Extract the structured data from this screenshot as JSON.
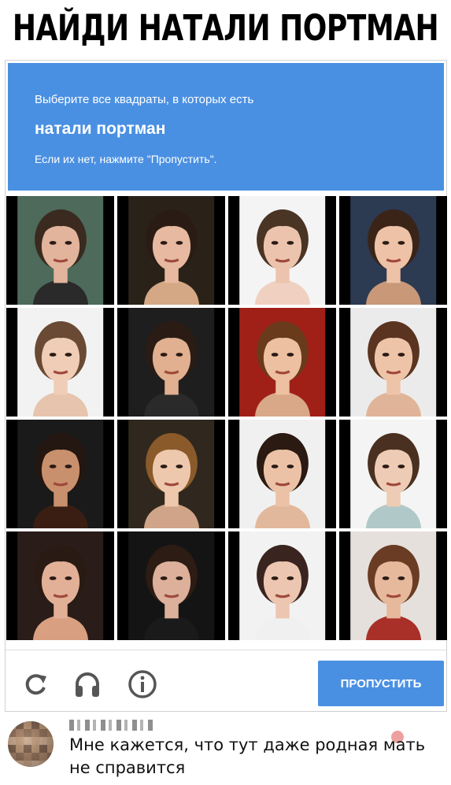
{
  "meme_title": "НАЙДИ НАТАЛИ ПОРТМАН",
  "captcha": {
    "instruction": "Выберите все квадраты, в которых есть",
    "target": "натали портман",
    "hint": "Если их нет, нажмите \"Пропустить\".",
    "skip_label": "ПРОПУСТИТЬ",
    "header_color": "#4a90e2",
    "tiles": [
      {
        "bg": "#4d6a5a",
        "hair": "#3a2a20",
        "skin": "#e2b49c",
        "clothes": "#2a2a2a"
      },
      {
        "bg": "#2a2218",
        "hair": "#2a1c14",
        "skin": "#e6b9a0",
        "clothes": "#d4a884"
      },
      {
        "bg": "#f4f4f4",
        "hair": "#4a3424",
        "skin": "#ecc4ae",
        "clothes": "#f0d0c0"
      },
      {
        "bg": "#2c3a52",
        "hair": "#3a2418",
        "skin": "#eec2a6",
        "clothes": "#c89878"
      },
      {
        "bg": "#f2f2f2",
        "hair": "#6a4a34",
        "skin": "#f0cdb6",
        "clothes": "#e6c4ae"
      },
      {
        "bg": "#1e1e1e",
        "hair": "#2a1c14",
        "skin": "#e0b090",
        "clothes": "#2a2a2a"
      },
      {
        "bg": "#a02018",
        "hair": "#6a3a1c",
        "skin": "#ecc0a0",
        "clothes": "#d8a888"
      },
      {
        "bg": "#ebebeb",
        "hair": "#5a3420",
        "skin": "#eec4a8",
        "clothes": "#e0b498"
      },
      {
        "bg": "#1a1a1a",
        "hair": "#241610",
        "skin": "#c8906c",
        "clothes": "#3a1e14"
      },
      {
        "bg": "#30281e",
        "hair": "#8a5a2a",
        "skin": "#eec8ac",
        "clothes": "#d0a488"
      },
      {
        "bg": "#f0f0f0",
        "hair": "#2a1a12",
        "skin": "#ecc2a6",
        "clothes": "#e2b89c"
      },
      {
        "bg": "#f4f4f4",
        "hair": "#4a3020",
        "skin": "#eecbb4",
        "clothes": "#b0c8c8"
      },
      {
        "bg": "#2a1c18",
        "hair": "#2a1a14",
        "skin": "#e2b096",
        "clothes": "#d8a080"
      },
      {
        "bg": "#141414",
        "hair": "#2c1c14",
        "skin": "#dcb09a",
        "clothes": "#1a1a1a"
      },
      {
        "bg": "#f2f2f2",
        "hair": "#3a2420",
        "skin": "#ecc6b0",
        "clothes": "#f0f0f0"
      },
      {
        "bg": "#e6e0dc",
        "hair": "#6a3c24",
        "skin": "#e6b89c",
        "clothes": "#a83028"
      }
    ]
  },
  "comment": {
    "text": "Мне кажется, что тут даже родная мать не справится"
  },
  "icons": [
    "reload-icon",
    "headphones-icon",
    "info-icon"
  ]
}
